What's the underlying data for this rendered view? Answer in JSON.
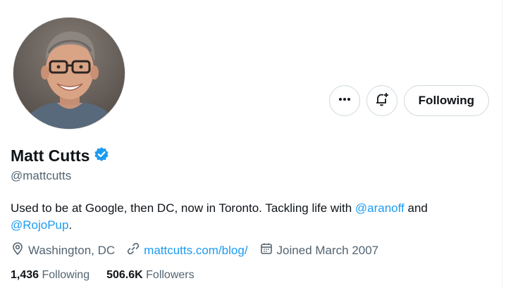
{
  "profile": {
    "name": "Matt Cutts",
    "handle": "@mattcutts",
    "bio_prefix": "Used to be at Google, then DC, now in Toronto. Tackling life with ",
    "mention_1": "@aranoff",
    "bio_middle": " and ",
    "mention_2": "@RojoPup",
    "bio_suffix": ".",
    "location": "Washington, DC",
    "website": "mattcutts.com/blog/",
    "joined": "Joined March 2007"
  },
  "actions": {
    "more_label": "•••",
    "follow_label": "Following"
  },
  "stats": {
    "following_count": "1,436",
    "following_label": "Following",
    "followers_count": "506.6K",
    "followers_label": "Followers"
  },
  "icons": {
    "more": "more-icon",
    "notify": "bell-plus-icon",
    "verified": "verified-badge-icon",
    "location": "location-pin-icon",
    "link": "link-icon",
    "calendar": "calendar-icon"
  },
  "colors": {
    "accent": "#1d9bf0",
    "text_primary": "#0f1419",
    "text_secondary": "#536471",
    "border": "#cfd9de"
  }
}
